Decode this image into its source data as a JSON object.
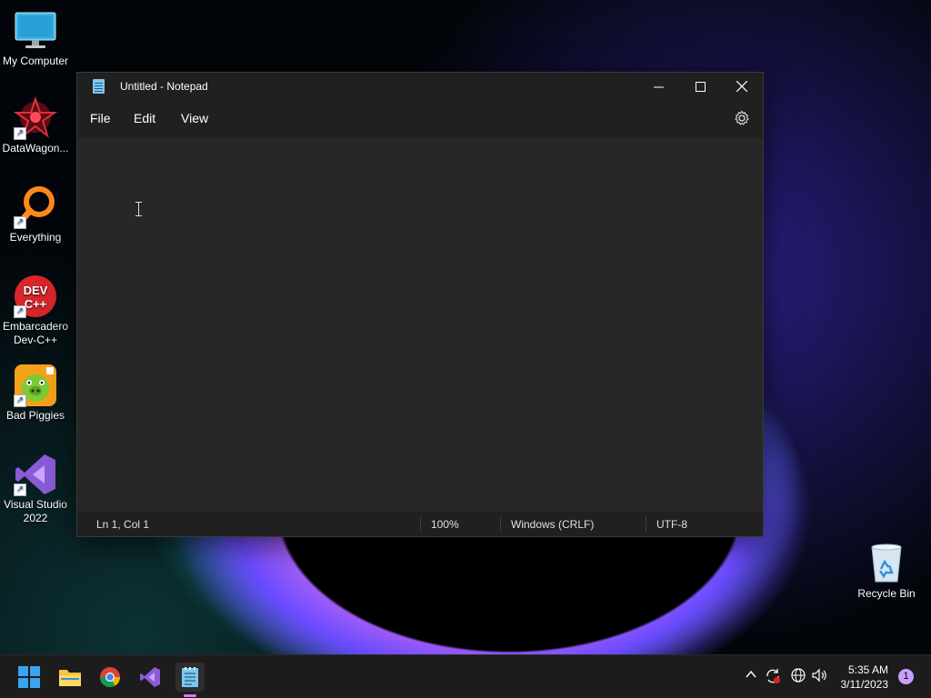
{
  "desktop": {
    "icons": [
      {
        "label": "My Computer"
      },
      {
        "label": "DataWagon..."
      },
      {
        "label": "Everything"
      },
      {
        "label_line1": "Embarcadero",
        "label_line2": "Dev-C++",
        "glyph_text": "DEV C++"
      },
      {
        "label": "Bad Piggies"
      },
      {
        "label_line1": "Visual Studio",
        "label_line2": "2022"
      },
      {
        "label": "Recycle Bin"
      }
    ]
  },
  "notepad": {
    "title": "Untitled - Notepad",
    "menu": {
      "file": "File",
      "edit": "Edit",
      "view": "View"
    },
    "editor_text": "",
    "status": {
      "position": "Ln 1, Col 1",
      "zoom": "100%",
      "line_ending": "Windows (CRLF)",
      "encoding": "UTF-8"
    }
  },
  "taskbar": {
    "pinned": [
      "start-icon",
      "file-explorer-icon",
      "chrome-icon",
      "visual-studio-icon",
      "notepad-icon"
    ],
    "clock": {
      "time": "5:35 AM",
      "date": "3/11/2023"
    },
    "notification_count": "1"
  },
  "colors": {
    "window_bg": "#272727",
    "titlebar_bg": "#202020",
    "taskbar_bg": "#1c1c1c",
    "accent": "#d07cff"
  }
}
